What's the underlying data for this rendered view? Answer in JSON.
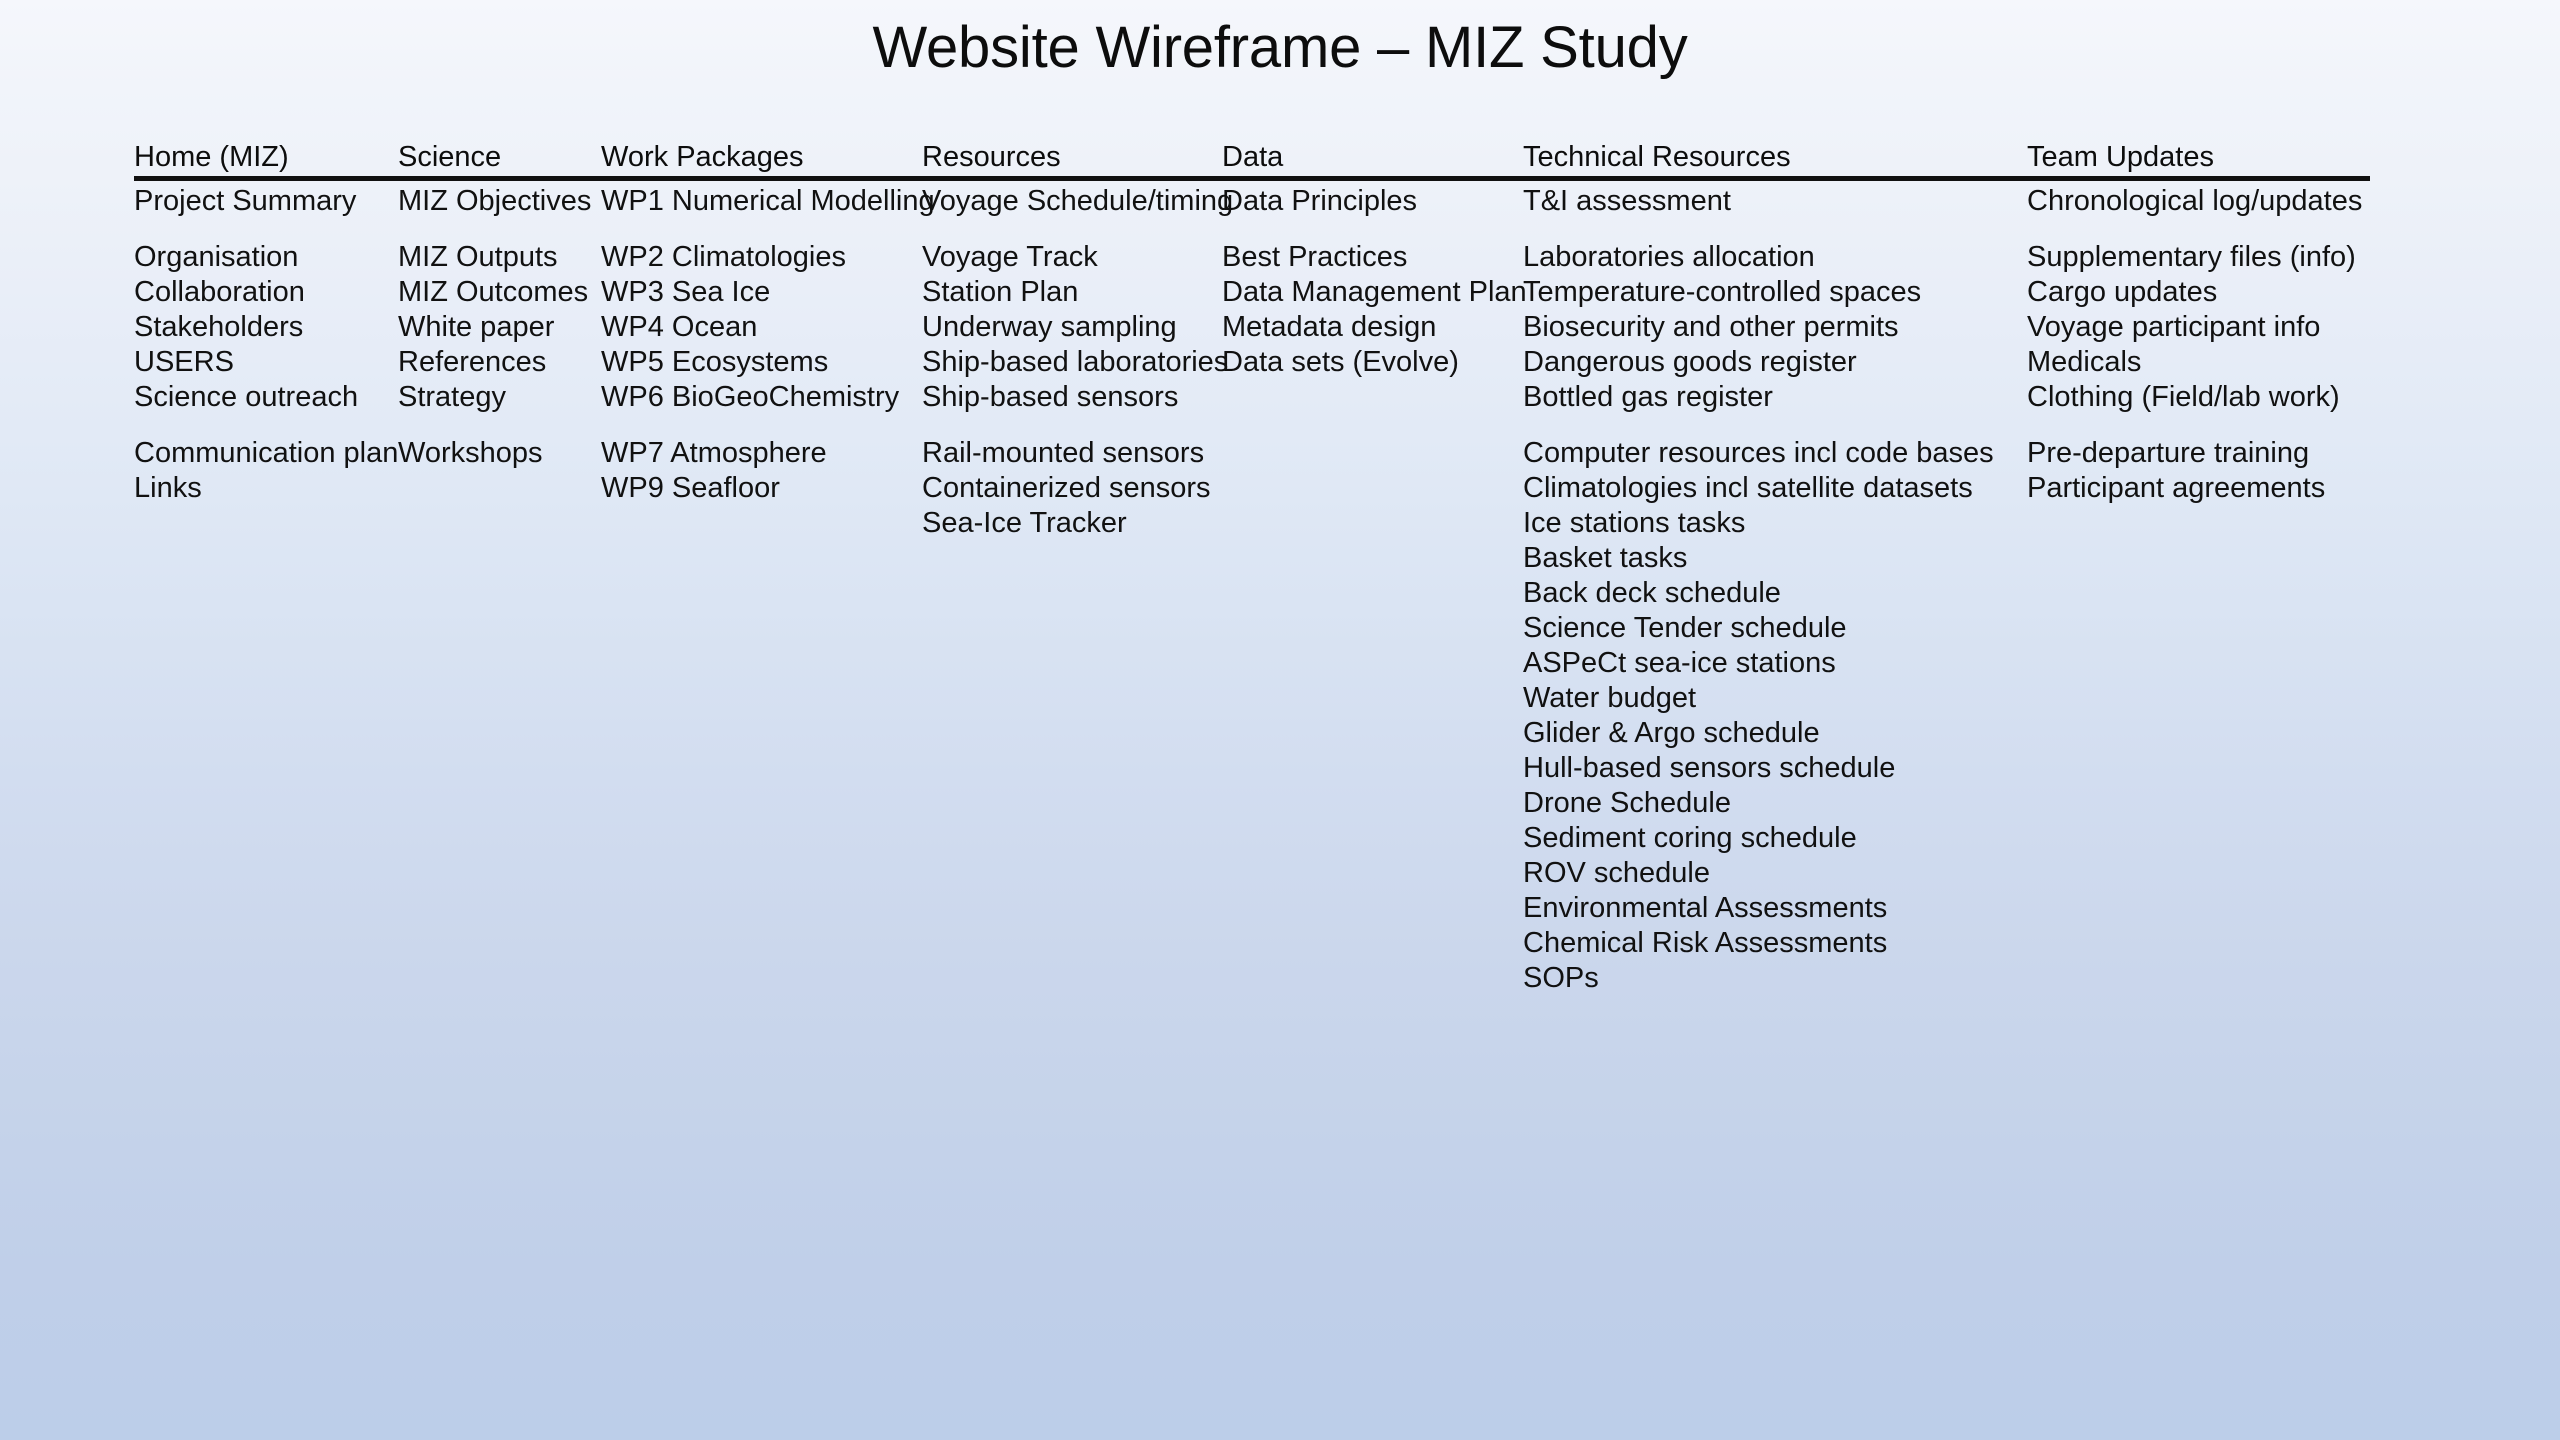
{
  "slide": {
    "title": "Website Wireframe – MIZ Study"
  },
  "colors": {
    "background_top": "#f5f7fc",
    "background_bottom": "#bccee9",
    "rule": "#111111",
    "text": "#111111"
  },
  "columns": [
    {
      "header": "Home (MIZ)",
      "groups": [
        [
          "Project Summary"
        ],
        [
          "Organisation",
          "Collaboration",
          "Stakeholders",
          "USERS",
          "Science outreach"
        ],
        [
          "Communication plan",
          "Links"
        ]
      ]
    },
    {
      "header": "Science",
      "groups": [
        [
          "MIZ Objectives"
        ],
        [
          "MIZ Outputs",
          "MIZ Outcomes",
          "White paper",
          "References",
          "Strategy"
        ],
        [
          "Workshops"
        ]
      ]
    },
    {
      "header": "Work Packages",
      "groups": [
        [
          "WP1 Numerical Modelling"
        ],
        [
          "WP2 Climatologies",
          "WP3 Sea Ice",
          "WP4 Ocean",
          "WP5 Ecosystems",
          "WP6 BioGeoChemistry"
        ],
        [
          "WP7 Atmosphere",
          "WP9 Seafloor"
        ]
      ]
    },
    {
      "header": "Resources",
      "groups": [
        [
          "Voyage Schedule/timing"
        ],
        [
          "Voyage Track",
          "Station Plan",
          "Underway sampling",
          "Ship-based laboratories",
          "Ship-based sensors"
        ],
        [
          "Rail-mounted sensors",
          "Containerized sensors",
          "Sea-Ice Tracker"
        ]
      ]
    },
    {
      "header": "Data",
      "groups": [
        [
          "Data Principles"
        ],
        [
          "Best Practices",
          "Data Management Plan",
          "Metadata design",
          "Data sets (Evolve)"
        ]
      ]
    },
    {
      "header": "Technical Resources",
      "groups": [
        [
          "T&I assessment"
        ],
        [
          "Laboratories allocation",
          "Temperature-controlled spaces",
          "Biosecurity and other permits",
          "Dangerous goods register",
          "Bottled gas register"
        ],
        [
          "Computer resources incl code bases",
          "Climatologies incl satellite datasets",
          "Ice stations tasks",
          "Basket tasks",
          "Back deck schedule",
          "Science Tender schedule",
          "ASPeCt sea-ice stations",
          "Water budget",
          "Glider & Argo schedule",
          "Hull-based sensors schedule",
          "Drone Schedule",
          "Sediment coring schedule",
          "ROV schedule",
          "Environmental Assessments",
          "Chemical Risk Assessments",
          "SOPs"
        ]
      ]
    },
    {
      "header": "Team Updates",
      "groups": [
        [
          "Chronological log/updates"
        ],
        [
          "Supplementary files (info)",
          "Cargo updates",
          "Voyage participant info",
          "Medicals",
          "Clothing (Field/lab work)"
        ],
        [
          "Pre-departure training",
          "Participant agreements"
        ]
      ]
    }
  ]
}
